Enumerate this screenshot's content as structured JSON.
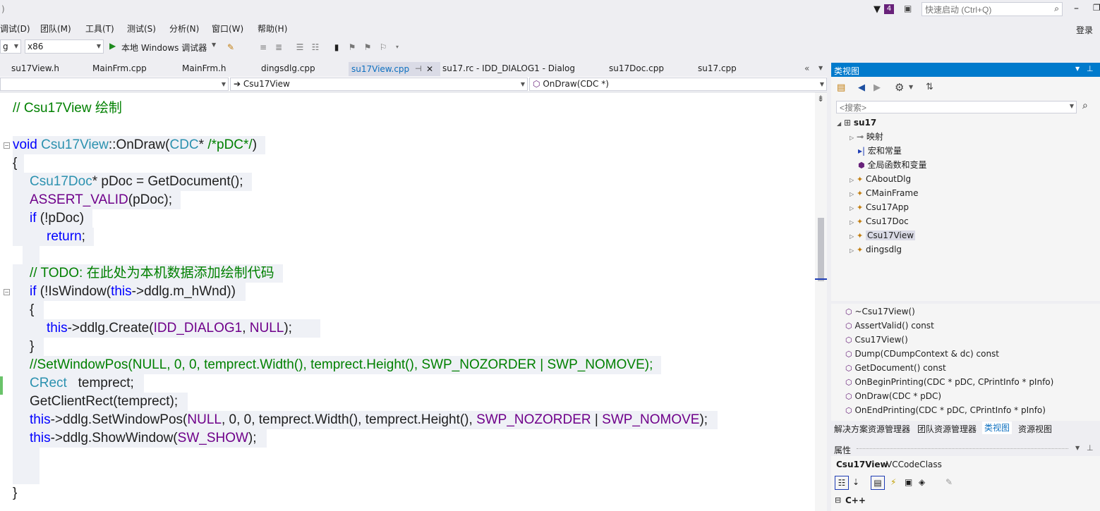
{
  "title_fragment": ")",
  "topbar": {
    "notification_count": "4",
    "quick_launch_placeholder": "快速启动 (Ctrl+Q)",
    "login": "登录"
  },
  "menu": [
    "调试(D)",
    "团队(M)",
    "工具(T)",
    "测试(S)",
    "分析(N)",
    "窗口(W)",
    "帮助(H)"
  ],
  "toolbar": {
    "config": "g",
    "platform": "x86",
    "debugger": "本地 Windows 调试器"
  },
  "tabs": [
    {
      "label": "su17View.h",
      "active": false
    },
    {
      "label": "MainFrm.cpp",
      "active": false
    },
    {
      "label": "MainFrm.h",
      "active": false
    },
    {
      "label": "dingsdlg.cpp",
      "active": false
    },
    {
      "label": "su17View.cpp",
      "active": true
    },
    {
      "label": "su17.rc - IDD_DIALOG1 - Dialog",
      "active": false
    },
    {
      "label": "su17Doc.cpp",
      "active": false
    },
    {
      "label": "su17.cpp",
      "active": false
    }
  ],
  "nav": {
    "scope": "",
    "class": "Csu17View",
    "member": "OnDraw(CDC *)"
  },
  "code": {
    "l01": "// Csu17View 绘制",
    "l02a": "void",
    "l02b": "Csu17View",
    "l02c": "::OnDraw(",
    "l02d": "CDC",
    "l02e": "* ",
    "l02f": "/*pDC*/",
    "l02g": ")",
    "l03": "{",
    "l04a": "Csu17Doc",
    "l04b": "* pDoc = GetDocument();",
    "l05a": "ASSERT_VALID",
    "l05b": "(pDoc);",
    "l06a": "if",
    "l06b": " (!pDoc)",
    "l07a": "return",
    "l07b": ";",
    "l08": "// TODO: 在此处为本机数据添加绘制代码",
    "l09a": "if",
    "l09b": " (!IsWindow(",
    "l09c": "this",
    "l09d": "->ddlg.m_hWnd))",
    "l10": "{",
    "l11a": "this",
    "l11b": "->ddlg.Create(",
    "l11c": "IDD_DIALOG1",
    "l11d": ", ",
    "l11e": "NULL",
    "l11f": ");",
    "l12": "}",
    "l13": "//SetWindowPos(NULL, 0, 0, temprect.Width(), temprect.Height(), SWP_NOZORDER | SWP_NOMOVE);",
    "l14a": "CRect",
    "l14b": "   temprect;",
    "l15": "GetClientRect(temprect);",
    "l16a": "this",
    "l16b": "->ddlg.SetWindowPos(",
    "l16c": "NULL",
    "l16d": ", 0, 0, temprect.Width(), temprect.Height(), ",
    "l16e": "SWP_NOZORDER",
    "l16f": " | ",
    "l16g": "SWP_NOMOVE",
    "l16h": ");",
    "l17a": "this",
    "l17b": "->ddlg.ShowWindow(",
    "l17c": "SW_SHOW",
    "l17d": ");",
    "l18": "}"
  },
  "classview": {
    "title": "类视图",
    "search_placeholder": "<搜索>",
    "project": "su17",
    "nodes": [
      "映射",
      "宏和常量",
      "全局函数和变量"
    ],
    "classes": [
      "CAboutDlg",
      "CMainFrame",
      "Csu17App",
      "Csu17Doc",
      "Csu17View",
      "dingsdlg"
    ],
    "selected_class": "Csu17View"
  },
  "members": [
    "~Csu17View()",
    "AssertValid() const",
    "Csu17View()",
    "Dump(CDumpContext & dc) const",
    "GetDocument() const",
    "OnBeginPrinting(CDC * pDC, CPrintInfo * pInfo)",
    "OnDraw(CDC * pDC)",
    "OnEndPrinting(CDC * pDC, CPrintInfo * pInfo)"
  ],
  "bottom_tabs": [
    "解决方案资源管理器",
    "团队资源管理器",
    "类视图",
    "资源视图"
  ],
  "active_bottom_tab": "类视图",
  "properties": {
    "title": "属性",
    "object_name": "Csu17View",
    "object_type": "VCCodeClass",
    "category": "C++"
  },
  "colors": {
    "accent": "#007acc",
    "keyword": "#0000ff",
    "type": "#2b91af",
    "macro": "#6f008a",
    "comment": "#008000"
  }
}
